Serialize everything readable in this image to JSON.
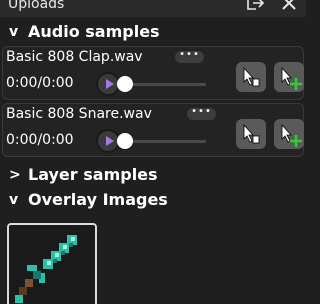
{
  "panel": {
    "title": "Uploads"
  },
  "sections": {
    "audio": {
      "chevron": "v",
      "label": "Audio samples"
    },
    "layer": {
      "chevron": ">",
      "label": "Layer samples"
    },
    "overlay": {
      "chevron": "v",
      "label": "Overlay Images"
    }
  },
  "audio_items": [
    {
      "name": "Basic 808 Clap.wav",
      "menu_label": "•••",
      "time": "0:00/0:00",
      "progress": 0
    },
    {
      "name": "Basic 808 Snare.wav",
      "menu_label": "•••",
      "time": "0:00/0:00",
      "progress": 0
    }
  ],
  "overlay_images": [
    {
      "icon": "diamond-sword-icon"
    }
  ],
  "colors": {
    "background": "#1f1f1f",
    "card": "#232323",
    "play_icon": "#a678e6",
    "add_green": "#33cc33",
    "sword_blade": "#2fbfa8",
    "sword_handle": "#7a5230"
  }
}
